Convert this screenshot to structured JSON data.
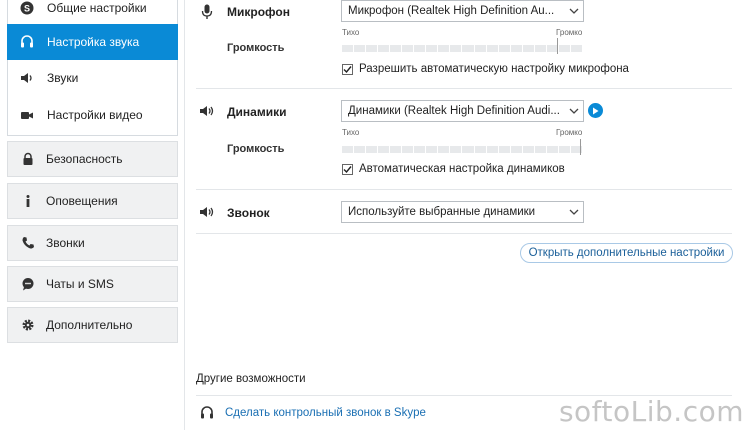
{
  "sidebar": {
    "items": [
      {
        "label": "Общие настройки",
        "icon": "skype-logo-icon"
      },
      {
        "label": "Настройка звука",
        "icon": "headset-icon",
        "active": true
      },
      {
        "label": "Звуки",
        "icon": "speaker-icon"
      },
      {
        "label": "Настройки видео",
        "icon": "camera-icon"
      }
    ],
    "categories": [
      {
        "label": "Безопасность",
        "icon": "lock-icon"
      },
      {
        "label": "Оповещения",
        "icon": "info-icon"
      },
      {
        "label": "Звонки",
        "icon": "phone-icon"
      },
      {
        "label": "Чаты и SMS",
        "icon": "chat-icon"
      },
      {
        "label": "Дополнительно",
        "icon": "gear-icon"
      }
    ]
  },
  "microphone": {
    "label": "Микрофон",
    "device": "Микрофон (Realtek High Definition Au...",
    "volume_label": "Громкость",
    "low": "Тихо",
    "high": "Громко",
    "auto_label": "Разрешить автоматическую настройку микрофона",
    "auto_checked": true
  },
  "speakers": {
    "label": "Динамики",
    "device": "Динамики (Realtek High Definition Audi...",
    "volume_label": "Громкость",
    "low": "Тихо",
    "high": "Громко",
    "auto_label": "Автоматическая настройка динамиков",
    "auto_checked": true
  },
  "ringer": {
    "label": "Звонок",
    "device": "Используйте выбранные динамики"
  },
  "advanced_button": "Открыть дополнительные настройки",
  "other": {
    "title": "Другие возможности",
    "test_call_link": "Сделать контрольный звонок в Skype"
  },
  "watermark": "softoLib.com",
  "colors": {
    "accent": "#0a8ad6",
    "link": "#1a6fb3"
  }
}
